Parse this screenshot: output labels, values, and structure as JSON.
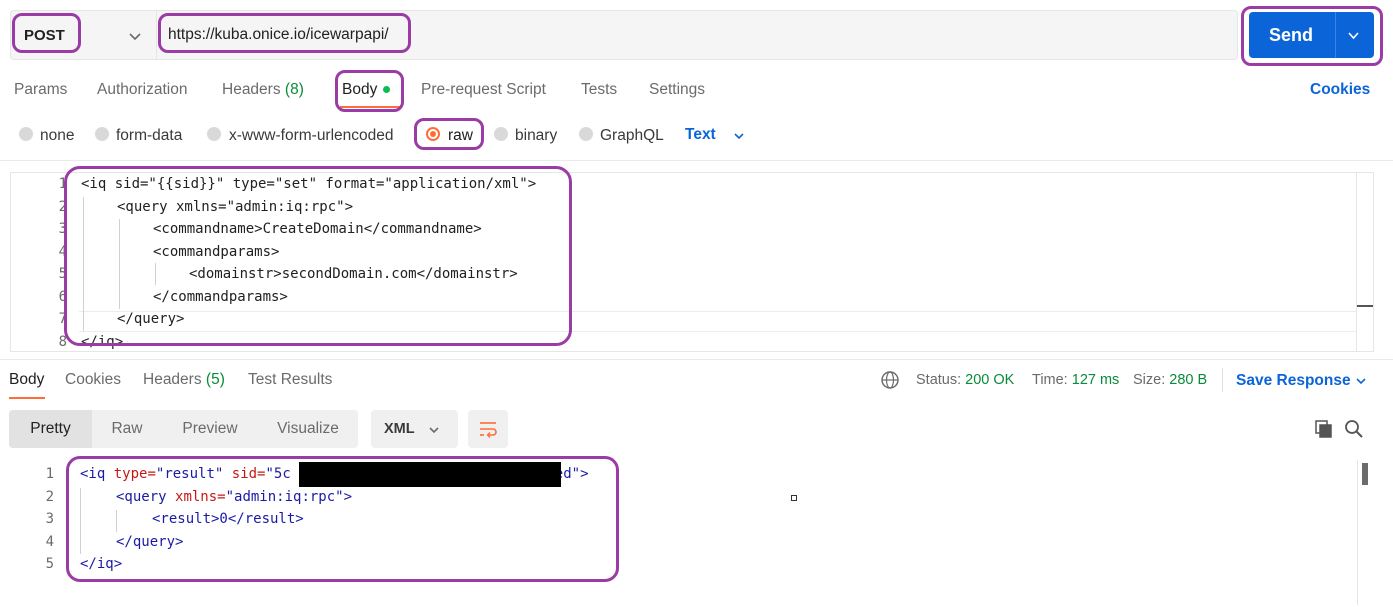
{
  "request": {
    "method": "POST",
    "url": "https://kuba.onice.io/icewarpapi/",
    "send_label": "Send",
    "tabs": [
      {
        "label": "Params"
      },
      {
        "label": "Authorization"
      },
      {
        "label": "Headers",
        "count": "(8)"
      },
      {
        "label": "Body"
      },
      {
        "label": "Pre-request Script"
      },
      {
        "label": "Tests"
      },
      {
        "label": "Settings"
      }
    ],
    "cookies_label": "Cookies",
    "body_types": [
      "none",
      "form-data",
      "x-www-form-urlencoded",
      "raw",
      "binary",
      "GraphQL"
    ],
    "selected_body_type": "raw",
    "text_format": "Text",
    "body_lines": [
      {
        "n": "1",
        "text": "<iq sid=\"{{sid}}\" type=\"set\" format=\"application/xml\">"
      },
      {
        "n": "2",
        "text": "<query xmlns=\"admin:iq:rpc\">"
      },
      {
        "n": "3",
        "text": "<commandname>CreateDomain</commandname>"
      },
      {
        "n": "4",
        "text": "<commandparams>"
      },
      {
        "n": "5",
        "text": "<domainstr>secondDomain.com</domainstr>"
      },
      {
        "n": "6",
        "text": "</commandparams>"
      },
      {
        "n": "7",
        "text": "</query>"
      },
      {
        "n": "8",
        "text": "</iq>"
      }
    ]
  },
  "response": {
    "tabs": [
      {
        "label": "Body"
      },
      {
        "label": "Cookies"
      },
      {
        "label": "Headers",
        "count": "(5)"
      },
      {
        "label": "Test Results"
      }
    ],
    "status_label": "Status:",
    "status_value": "200 OK",
    "time_label": "Time:",
    "time_value": "127 ms",
    "size_label": "Size:",
    "size_value": "280 B",
    "save_label": "Save Response",
    "view_modes": [
      "Pretty",
      "Raw",
      "Preview",
      "Visualize"
    ],
    "format": "XML",
    "lines": [
      {
        "n": "1"
      },
      {
        "n": "2"
      },
      {
        "n": "3"
      },
      {
        "n": "4"
      },
      {
        "n": "5"
      }
    ],
    "xml": {
      "iq_open": "<iq",
      "type_attr": "type=",
      "type_val": "\"result\"",
      "sid_attr": "sid=",
      "sid_val_start": "\"5c",
      "sid_val_end": "ed\"",
      "iq_close_bracket": ">",
      "query_open": "<query",
      "xmlns_attr": "xmlns=",
      "xmlns_val": "\"admin:iq:rpc\"",
      "query_close_bracket": ">",
      "result_line": "<result>0</result>",
      "query_end": "</query>",
      "iq_end": "</iq>"
    }
  },
  "colors": {
    "accent": "#ff6c37",
    "send": "#0b65d8",
    "annotation": "#9b3ca6",
    "status_ok": "#0a8a3a"
  }
}
